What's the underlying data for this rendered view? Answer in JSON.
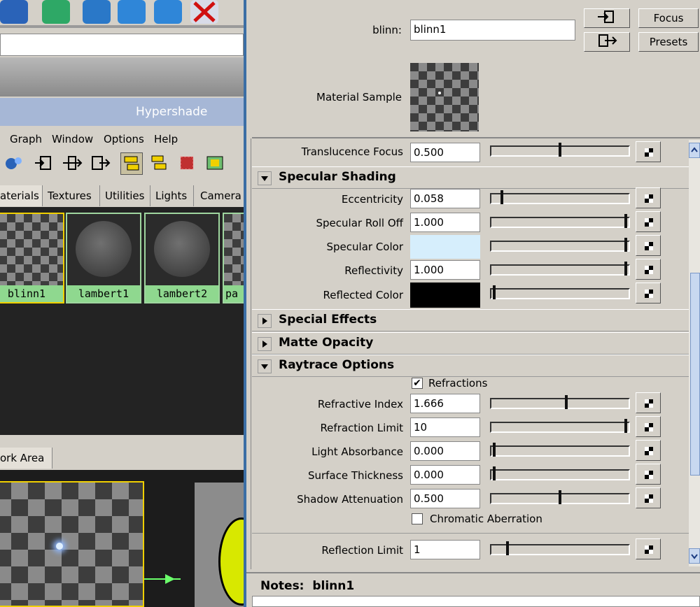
{
  "left_panel": {
    "hypershade_title": "Hypershade",
    "menu": [
      "Graph",
      "Window",
      "Options",
      "Help"
    ],
    "tabs": [
      "aterials",
      "Textures",
      "Utilities",
      "Lights",
      "Camera"
    ],
    "swatches": [
      "blinn1",
      "lambert1",
      "lambert2",
      "pa"
    ],
    "work_area_tab": "ork Area"
  },
  "header": {
    "node_label": "blinn:",
    "node_name": "blinn1",
    "focus_button": "Focus",
    "presets_button": "Presets",
    "material_sample_label": "Material Sample"
  },
  "translucence_focus": {
    "label": "Translucence Focus",
    "value": "0.500",
    "slider": 0.5
  },
  "specular_section": {
    "title": "Specular Shading",
    "rows": [
      {
        "label": "Eccentricity",
        "value": "0.058",
        "slider": 0.06
      },
      {
        "label": "Specular Roll Off",
        "value": "1.000",
        "slider": 1.0
      },
      {
        "label": "Specular Color",
        "value": "",
        "slider": 1.0,
        "color": "#d6eefc"
      },
      {
        "label": "Reflectivity",
        "value": "1.000",
        "slider": 1.0
      },
      {
        "label": "Reflected Color",
        "value": "",
        "slider": 0.0,
        "color": "#000000"
      }
    ]
  },
  "collapsed_sections": [
    "Special Effects",
    "Matte Opacity"
  ],
  "raytrace_section": {
    "title": "Raytrace Options",
    "refractions_label": "Refractions",
    "refractions_checked": true,
    "rows": [
      {
        "label": "Refractive Index",
        "value": "1.666",
        "slider": 0.55
      },
      {
        "label": "Refraction Limit",
        "value": "10",
        "slider": 1.0
      },
      {
        "label": "Light Absorbance",
        "value": "0.000",
        "slider": 0.0
      },
      {
        "label": "Surface Thickness",
        "value": "0.000",
        "slider": 0.0
      },
      {
        "label": "Shadow Attenuation",
        "value": "0.500",
        "slider": 0.5
      }
    ],
    "chromatic_label": "Chromatic Aberration",
    "chromatic_checked": false,
    "reflection_limit": {
      "label": "Reflection Limit",
      "value": "1",
      "slider": 0.1
    }
  },
  "notes": {
    "label": "Notes:",
    "node": "blinn1"
  },
  "colors": {
    "hypershade_title_bar": "#a6b7d6",
    "swatch_label": "#8fd88f",
    "selection_blue": "#3b6ea5"
  }
}
